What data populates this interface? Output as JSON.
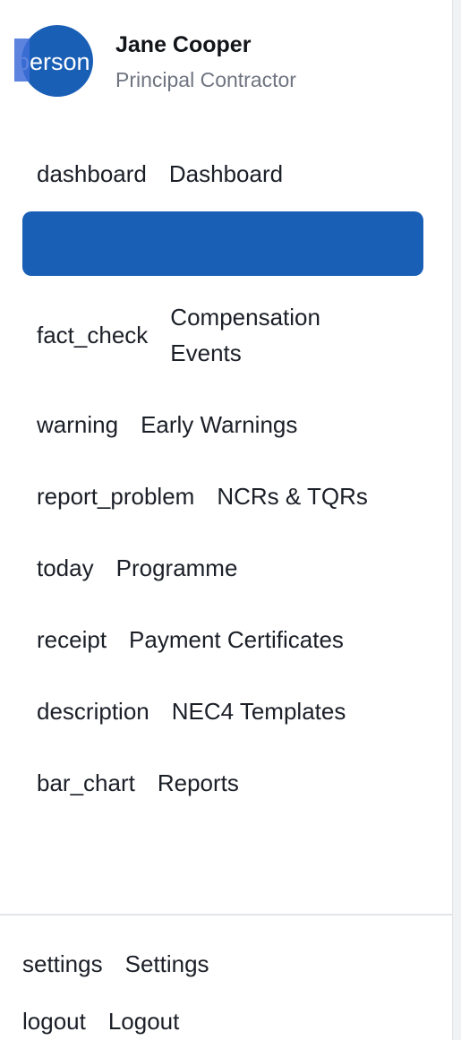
{
  "profile": {
    "avatar_icon": "person",
    "name": "Jane Cooper",
    "role": "Principal Contractor"
  },
  "nav": {
    "items": [
      {
        "icon": "dashboard",
        "label": "Dashboard"
      },
      {
        "icon": "",
        "label": "",
        "active": true
      },
      {
        "icon": "fact_check",
        "label": "Compensation Events"
      },
      {
        "icon": "warning",
        "label": "Early Warnings"
      },
      {
        "icon": "report_problem",
        "label": "NCRs & TQRs"
      },
      {
        "icon": "today",
        "label": "Programme"
      },
      {
        "icon": "receipt",
        "label": "Payment Certificates"
      },
      {
        "icon": "description",
        "label": "NEC4 Templates"
      },
      {
        "icon": "bar_chart",
        "label": "Reports"
      }
    ]
  },
  "footer": {
    "items": [
      {
        "icon": "settings",
        "label": "Settings"
      },
      {
        "icon": "logout",
        "label": "Logout"
      }
    ]
  },
  "colors": {
    "accent": "#1a5fb6",
    "text": "#1b1f27",
    "muted": "#6e7480"
  }
}
